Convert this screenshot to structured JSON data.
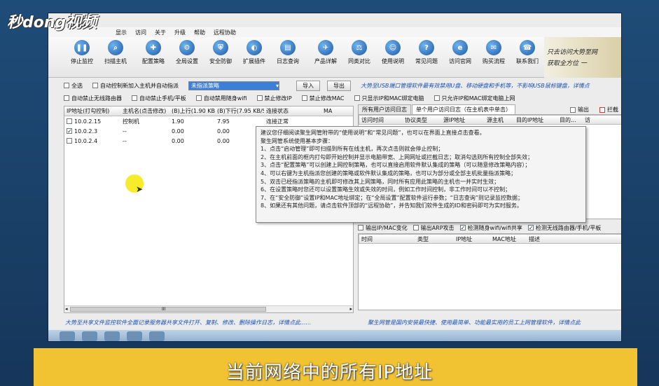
{
  "logo": "秒dong视频",
  "subtitle": "当前网络中的所有IP地址",
  "menu": [
    "显示",
    "访问",
    "关于",
    "升级",
    "帮助",
    "远程协助"
  ],
  "toolbar": [
    {
      "label": "停止监控",
      "icon": "pause-icon",
      "glyph": "❚❚"
    },
    {
      "label": "扫描主机",
      "icon": "search-icon",
      "glyph": "⌕"
    },
    {
      "label": "配置策略",
      "icon": "policy-icon",
      "glyph": "✚"
    },
    {
      "label": "全局设置",
      "icon": "settings-icon",
      "glyph": "⚙"
    },
    {
      "label": "安全防御",
      "icon": "shield-icon",
      "glyph": "⛨"
    },
    {
      "label": "扩展插件",
      "icon": "plugin-icon",
      "glyph": "◐"
    },
    {
      "label": "日志查询",
      "icon": "log-icon",
      "glyph": "▤"
    },
    {
      "label": "产品详解",
      "icon": "product-icon",
      "glyph": "✈"
    },
    {
      "label": "同类对比",
      "icon": "compare-icon",
      "glyph": "⚖"
    },
    {
      "label": "使用说明",
      "icon": "help-book-icon",
      "glyph": "☺"
    },
    {
      "label": "常见问题",
      "icon": "faq-icon",
      "glyph": "?"
    },
    {
      "label": "访问官网",
      "icon": "web-icon",
      "glyph": "e"
    },
    {
      "label": "购买流程",
      "icon": "cart-icon",
      "glyph": "✉"
    },
    {
      "label": "联系我们",
      "icon": "contact-icon",
      "glyph": "☎"
    }
  ],
  "banner": {
    "line1": "只去访问大势至网",
    "line2": "获取全方位 一"
  },
  "options1": {
    "select_all": "全选",
    "auto_add": "自动控制新加入主机并自动指派",
    "policy_select": "未指派策略",
    "import_btn": "导入",
    "export_btn": "导出",
    "promo": "大势至USB端口管理软件最有效禁用U盘、移动硬盘和手机等，不影响USB鼠标键盘，详情点"
  },
  "options2": [
    "自动禁止无线路由器",
    "自动禁止手机/平板",
    "自动禁用随身wifi",
    "禁止修改IP",
    "禁止修改MAC",
    "只显示IP和MAC绑定电脑",
    "只允许IP和MAC绑定电脑上网"
  ],
  "left_table": {
    "headers": [
      "IP地址(打勾控制)",
      "主机名(点击修改)",
      "(B)上行(1.90 KB/S)",
      "(B)下行(7.95 KB/S)",
      "连接状态",
      "MA"
    ],
    "rows": [
      {
        "checked": false,
        "ip": "10.0.2.15",
        "host": "控制机",
        "up": "1.90",
        "down": "7.95",
        "status": "连接正常"
      },
      {
        "checked": true,
        "ip": "10.0.2.3",
        "host": "--",
        "up": "0.00",
        "down": "0.00",
        "status": ""
      },
      {
        "checked": false,
        "ip": "10.0.2.4",
        "host": "--",
        "up": "0.00",
        "down": "0.00",
        "status": ""
      }
    ],
    "scroll_left": "◂",
    "scroll_mark": "III",
    "scroll_right": "▸"
  },
  "right_top": {
    "tab1": "所有用户访问日志",
    "tab2": "单个用户访问日志（在主机表中单击）",
    "export": "输出",
    "block": "拦截",
    "headers": [
      "访问时间",
      "协议类型",
      "源IP地址",
      "源主机",
      "目的IP地址",
      "目的...",
      "访"
    ]
  },
  "tooltip": [
    "建议您仔细阅读聚生网管附带的“使用说明”和“常见问题”，也可以在界面上直接点击查看。",
    "聚生网管系统使用基本步骤：",
    "1、点击“启动管理”即可扫描到所有在线主机，再次点击则就会停止控制；",
    "2、在主机前面的框内打勾即开始控制并显示电脑带宽、上网网址或拦截日志；取消勾选则所有控制全部失效；",
    "3、点击“配置策略”可以创建上网控制策略，也可以直接启用软件默认集成的策略（可以随意修改策略内容）；",
    "4、可以右键为主机指派您创建的策略或软件默认集成的策略，也可以为部分或全部主机批量指派策略；",
    "5、双击已经指派策略的主机即可修改其上网策略，同时所有应用此策略的主机也一并实时生效；",
    "6、在设置策略时您还可以设置策略生效或失效的时间，例如工作时间控制，非工作时间可以不控制；",
    "7、在“安全防御”设置IP和MAC地址绑定；在“全局设置”配置软件运行参数；“日志查询”则记录监控数据；",
    "8、如果还有其他问题，请点击软件顶部的“远程协助”，并告知我们软件生成的ID和密码即可为实时服务。"
  ],
  "right_bottom": {
    "checks": [
      {
        "label": "输出IP/MAC变化",
        "checked": false
      },
      {
        "label": "输出ARP攻击",
        "checked": false
      },
      {
        "label": "检测随身wifi/wifi共享",
        "checked": true
      },
      {
        "label": "检测无线路由器/手机/平板",
        "checked": true
      }
    ],
    "headers": [
      "时间",
      "类型",
      "IP地址",
      "MAC地址",
      "描述"
    ]
  },
  "status": {
    "left": "大势至共享文件监控软件全面记录服务器共享文件打开、复制、修改、删除操作日志，详情点此......",
    "right": "聚生网管是国内安装最快捷、使用最简单、功能最实用的员工上网管理软件，详情点此"
  }
}
